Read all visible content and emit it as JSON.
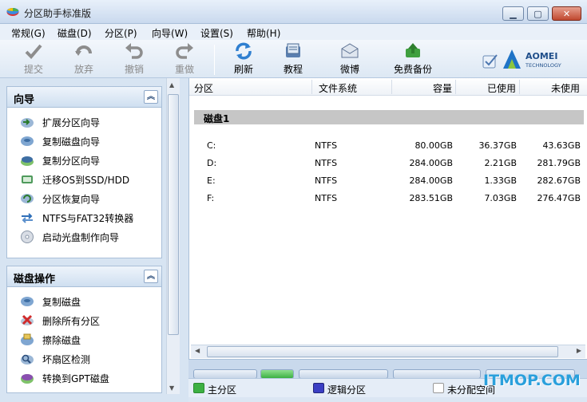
{
  "window": {
    "title": "分区助手标准版"
  },
  "menu": [
    "常规(G)",
    "磁盘(D)",
    "分区(P)",
    "向导(W)",
    "设置(S)",
    "帮助(H)"
  ],
  "toolbar": {
    "commit": "提交",
    "discard": "放弃",
    "undo": "撤销",
    "redo": "重做",
    "refresh": "刷新",
    "tutorial": "教程",
    "weibo": "微博",
    "free_backup": "免费备份"
  },
  "logo": {
    "brand": "AOMEI",
    "sub": "TECHNOLOGY"
  },
  "wizard_group": {
    "title": "向导",
    "items": [
      "扩展分区向导",
      "复制磁盘向导",
      "复制分区向导",
      "迁移OS到SSD/HDD",
      "分区恢复向导",
      "NTFS与FAT32转换器",
      "启动光盘制作向导"
    ]
  },
  "disk_group": {
    "title": "磁盘操作",
    "items": [
      "复制磁盘",
      "删除所有分区",
      "擦除磁盘",
      "坏扇区检测",
      "转换到GPT磁盘"
    ]
  },
  "table": {
    "columns": [
      "分区",
      "文件系统",
      "容量",
      "已使用",
      "未使用"
    ],
    "disk_label": "磁盘1",
    "rows": [
      {
        "partition": "C:",
        "fs": "NTFS",
        "capacity": "80.00GB",
        "used": "36.37GB",
        "free": "43.63GB"
      },
      {
        "partition": "D:",
        "fs": "NTFS",
        "capacity": "284.00GB",
        "used": "2.21GB",
        "free": "281.79GB"
      },
      {
        "partition": "E:",
        "fs": "NTFS",
        "capacity": "284.00GB",
        "used": "1.33GB",
        "free": "282.67GB"
      },
      {
        "partition": "F:",
        "fs": "NTFS",
        "capacity": "283.51GB",
        "used": "7.03GB",
        "free": "276.47GB"
      }
    ]
  },
  "legend": {
    "primary": "主分区",
    "logical": "逻辑分区",
    "unallocated": "未分配空间",
    "colors": {
      "primary": "#3cb043",
      "logical": "#3b3fc4",
      "unallocated": "#ffffff"
    }
  },
  "watermark": "ITMOP.COM"
}
